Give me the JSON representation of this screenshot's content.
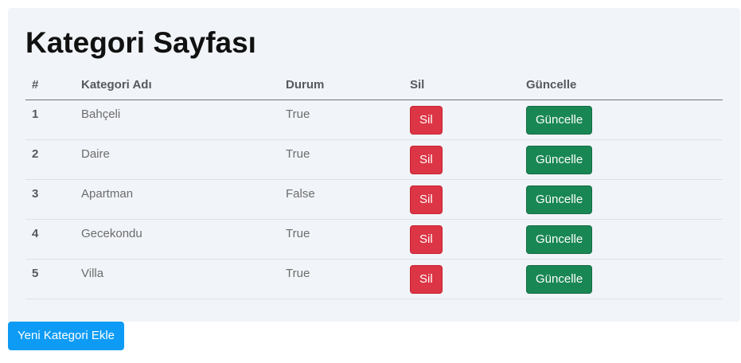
{
  "page": {
    "title": "Kategori Sayfası"
  },
  "table": {
    "headers": {
      "id": "#",
      "name": "Kategori Adı",
      "status": "Durum",
      "delete": "Sil",
      "update": "Güncelle"
    },
    "rows": [
      {
        "id": "1",
        "name": "Bahçeli",
        "status": "True",
        "delete_label": "Sil",
        "update_label": "Güncelle"
      },
      {
        "id": "2",
        "name": "Daire",
        "status": "True",
        "delete_label": "Sil",
        "update_label": "Güncelle"
      },
      {
        "id": "3",
        "name": "Apartman",
        "status": "False",
        "delete_label": "Sil",
        "update_label": "Güncelle"
      },
      {
        "id": "4",
        "name": "Gecekondu",
        "status": "True",
        "delete_label": "Sil",
        "update_label": "Güncelle"
      },
      {
        "id": "5",
        "name": "Villa",
        "status": "True",
        "delete_label": "Sil",
        "update_label": "Güncelle"
      }
    ]
  },
  "actions": {
    "add_label": "Yeni Kategori Ekle"
  },
  "colors": {
    "danger": "#dc3545",
    "success": "#198754",
    "primary": "#0d9bf5",
    "card_bg": "#f1f4f8"
  }
}
